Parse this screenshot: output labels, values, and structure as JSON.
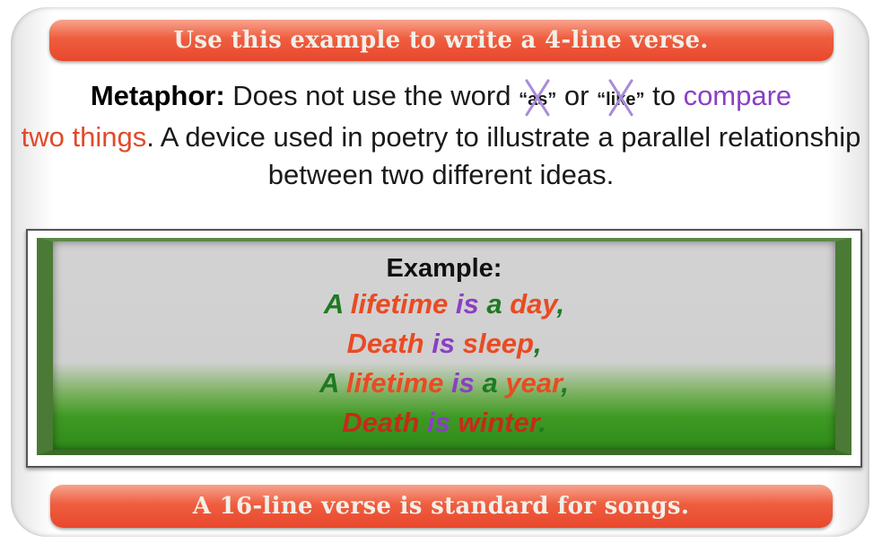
{
  "header": {
    "text": "Use this example to write a 4-line verse."
  },
  "definition": {
    "term": "Metaphor:",
    "text_1": " Does not use the word ",
    "word_as": "“as”",
    "text_or": " or ",
    "word_like": "“like”",
    "text_to": " to ",
    "compare": "compare",
    "two_things": "two things",
    "text_rest": ".  A device used in poetry to illustrate a parallel relationship between two different ideas."
  },
  "example": {
    "heading": "Example:",
    "line1": {
      "a": "A ",
      "subject": "lifetime ",
      "is": "is ",
      "a2": "a ",
      "object": "day",
      "end": ","
    },
    "line2": {
      "subject": "Death ",
      "is": "is ",
      "object": "sleep",
      "end": ","
    },
    "line3": {
      "a": "A ",
      "subject": "lifetime ",
      "is": "is ",
      "a2": "a ",
      "object": "year",
      "end": ","
    },
    "line4": {
      "subject": "Death ",
      "is": "is ",
      "object": "winter",
      "end": "."
    }
  },
  "footer": {
    "text": "A 16-line verse is standard for songs."
  },
  "colors": {
    "banner": "#ef5d3f",
    "green": "#1e7a22",
    "orange": "#ea4a23",
    "purple": "#8a3fc4",
    "red": "#c52b18"
  },
  "icons": {
    "cross": "cross-out-icon"
  }
}
